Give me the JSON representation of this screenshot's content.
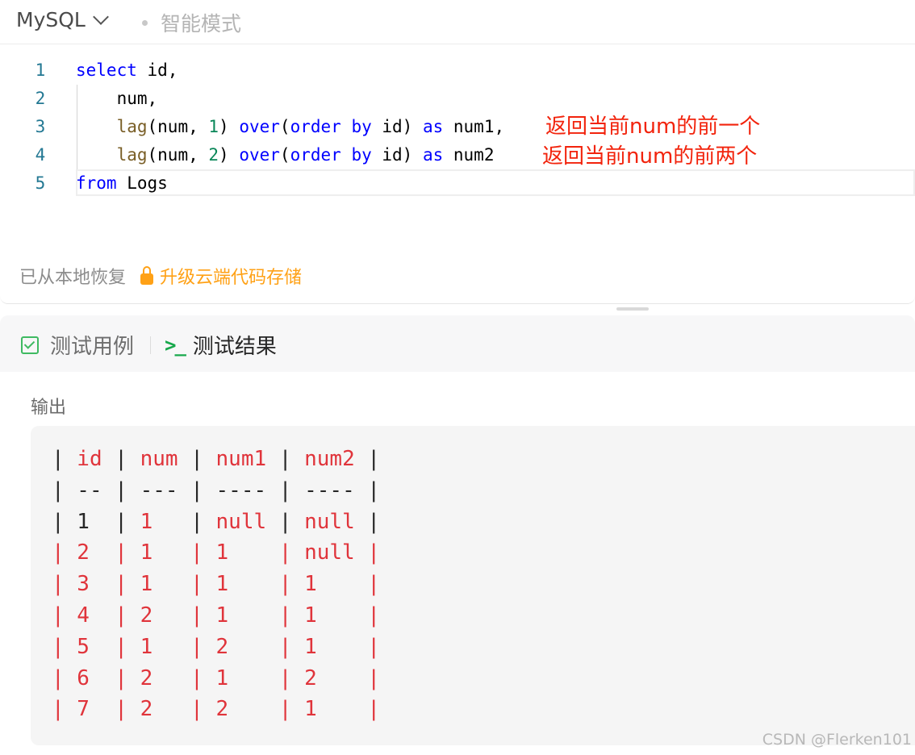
{
  "editor": {
    "language": "MySQL",
    "mode": "智能模式",
    "lines": [
      {
        "num": "1",
        "indent": "",
        "tokens": [
          [
            "kw",
            "select"
          ],
          [
            "t",
            " id,"
          ]
        ]
      },
      {
        "num": "2",
        "indent": "    ",
        "tokens": [
          [
            "t",
            "num,"
          ]
        ]
      },
      {
        "num": "3",
        "indent": "    ",
        "tokens": [
          [
            "fn",
            "lag"
          ],
          [
            "t",
            "(num, "
          ],
          [
            "nm",
            "1"
          ],
          [
            "t",
            ") "
          ],
          [
            "kw",
            "over"
          ],
          [
            "t",
            "("
          ],
          [
            "kw",
            "order"
          ],
          [
            "t",
            " "
          ],
          [
            "kw",
            "by"
          ],
          [
            "t",
            " id) "
          ],
          [
            "kw",
            "as"
          ],
          [
            "t",
            " num1,"
          ]
        ]
      },
      {
        "num": "4",
        "indent": "    ",
        "tokens": [
          [
            "fn",
            "lag"
          ],
          [
            "t",
            "(num, "
          ],
          [
            "nm",
            "2"
          ],
          [
            "t",
            ") "
          ],
          [
            "kw",
            "over"
          ],
          [
            "t",
            "("
          ],
          [
            "kw",
            "order"
          ],
          [
            "t",
            " "
          ],
          [
            "kw",
            "by"
          ],
          [
            "t",
            " id) "
          ],
          [
            "kw",
            "as"
          ],
          [
            "t",
            " num2"
          ]
        ]
      },
      {
        "num": "5",
        "indent": "",
        "tokens": [
          [
            "kw",
            "from"
          ],
          [
            "t",
            " Logs"
          ]
        ]
      }
    ],
    "annotations": {
      "line3": "返回当前num的前一个",
      "line4": "返回当前num的前两个"
    },
    "status_text": "已从本地恢复",
    "upgrade_text": "升级云端代码存储",
    "colors": {
      "keyword": "#0000ff",
      "function": "#795e26",
      "number": "#098658",
      "annotation": "#f2230c",
      "upgrade": "#ffa116"
    }
  },
  "result": {
    "tabs": [
      {
        "label": "测试用例",
        "icon": "checkbox-icon"
      },
      {
        "label": "测试结果",
        "icon": "terminal-icon"
      }
    ],
    "output_label": "输出",
    "table": {
      "headers": [
        "id",
        "num",
        "num1",
        "num2"
      ],
      "separator": [
        "--",
        "---",
        "----",
        "----"
      ],
      "rows": [
        [
          "1",
          "1",
          "null",
          "null"
        ],
        [
          "2",
          "1",
          "1",
          "null"
        ],
        [
          "3",
          "1",
          "1",
          "1"
        ],
        [
          "4",
          "2",
          "1",
          "1"
        ],
        [
          "5",
          "1",
          "2",
          "1"
        ],
        [
          "6",
          "2",
          "1",
          "2"
        ],
        [
          "7",
          "2",
          "2",
          "1"
        ]
      ]
    },
    "colors": {
      "diff": "#e0343b",
      "plain": "#262626",
      "terminal": "#17a84b",
      "check": "#3fba62"
    }
  },
  "watermark": "CSDN @Flerken101"
}
